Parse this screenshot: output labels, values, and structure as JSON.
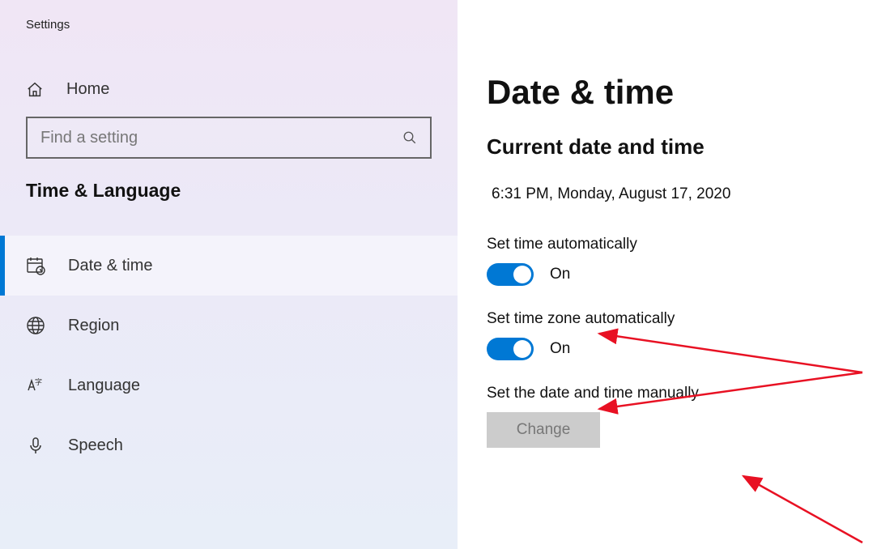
{
  "app_title": "Settings",
  "home_label": "Home",
  "search_placeholder": "Find a setting",
  "section_title": "Time & Language",
  "nav": [
    {
      "label": "Date & time"
    },
    {
      "label": "Region"
    },
    {
      "label": "Language"
    },
    {
      "label": "Speech"
    }
  ],
  "page_title": "Date & time",
  "sub_heading": "Current date and time",
  "datetime_value": "6:31 PM, Monday, August 17, 2020",
  "set_time_auto_label": "Set time automatically",
  "set_time_auto_state": "On",
  "set_tz_auto_label": "Set time zone automatically",
  "set_tz_auto_state": "On",
  "manual_label": "Set the date and time manually",
  "change_button": "Change"
}
